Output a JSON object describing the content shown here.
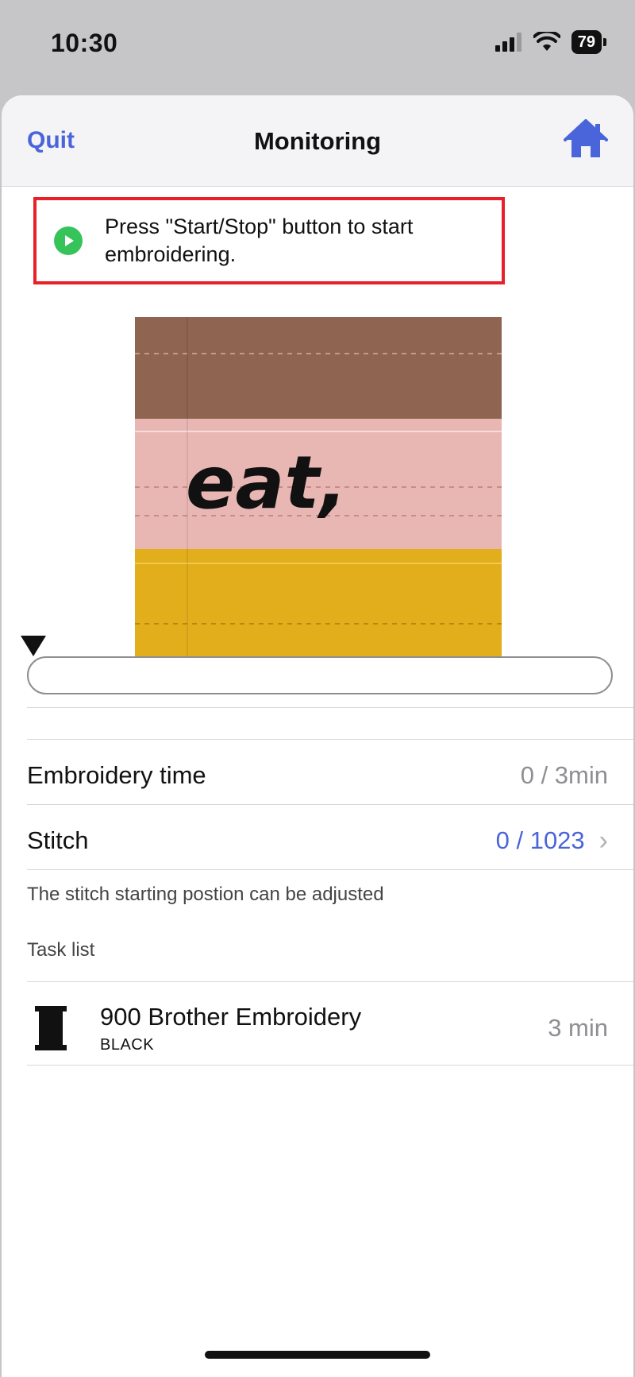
{
  "status_bar": {
    "time": "10:30",
    "battery": "79"
  },
  "navbar": {
    "quit_label": "Quit",
    "title": "Monitoring"
  },
  "notice": {
    "text": "Press \"Start/Stop\" button to start embroidering."
  },
  "preview": {
    "text": "eat,"
  },
  "progress": {
    "fraction": 0
  },
  "embroidery_time": {
    "label": "Embroidery time",
    "value": "0 / 3min"
  },
  "stitch": {
    "label": "Stitch",
    "value": "0 / 1023"
  },
  "stitch_note": "The stitch starting postion can be adjusted",
  "task_list": {
    "header": "Task list",
    "items": [
      {
        "name": "900 Brother Embroidery",
        "color_name": "BLACK",
        "duration": "3 min",
        "thread_color": "#111111"
      }
    ]
  },
  "colors": {
    "accent": "#4a64d9",
    "highlight_border": "#e8202a",
    "play_green": "#35c35a"
  }
}
